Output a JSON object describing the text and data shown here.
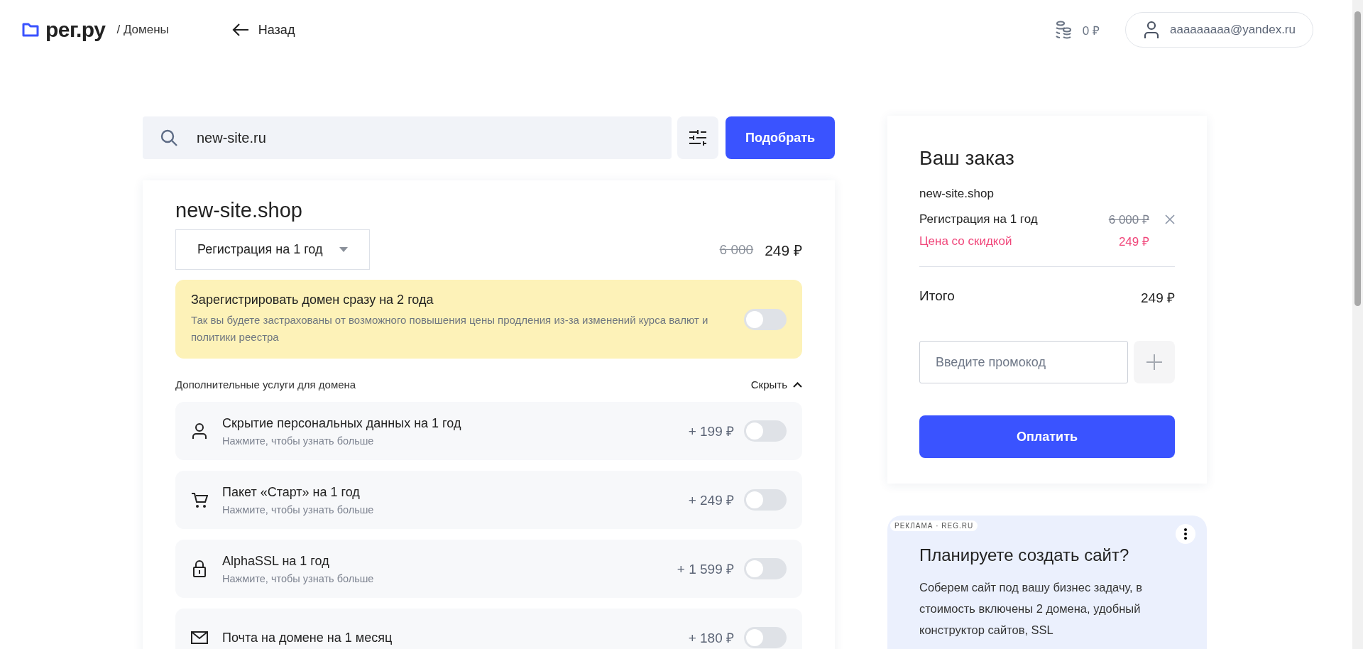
{
  "header": {
    "logo": "рег.ру",
    "section": "/ Домены",
    "back": "Назад",
    "balance": "0 ₽",
    "user": "aaaaaaaaa@yandex.ru"
  },
  "search": {
    "value": "new-site.ru",
    "button": "Подобрать"
  },
  "domain": {
    "name": "new-site.shop",
    "period": "Регистрация на 1 год",
    "old_price": "6 000",
    "price": "249 ₽",
    "promo": {
      "title": "Зарегистрировать домен сразу на 2 года",
      "text": "Так вы будете застрахованы от возможного повышения цены продления из-за изменений курса валют и политики реестра",
      "on": false
    },
    "services_title": "Дополнительные услуги для домена",
    "toggle_label": "Скрыть",
    "expanded": true,
    "services": [
      {
        "kind": "person",
        "title": "Скрытие персональных данных на 1 год",
        "subtitle": "Нажмите, чтобы узнать больше",
        "price": "+ 199 ₽",
        "on": false
      },
      {
        "kind": "cart",
        "title": "Пакет «Старт» на 1 год",
        "subtitle": "Нажмите, чтобы узнать больше",
        "price": "+ 249 ₽",
        "on": false
      },
      {
        "kind": "lock",
        "title": "AlphaSSL на 1 год",
        "subtitle": "Нажмите, чтобы узнать больше",
        "price": "+ 1 599 ₽",
        "on": false
      },
      {
        "kind": "mail",
        "title": "Почта на домене на 1 месяц",
        "price": "+ 180 ₽",
        "on": false
      }
    ]
  },
  "order": {
    "title": "Ваш заказ",
    "domain": "new-site.shop",
    "lines": [
      {
        "kind": "old",
        "label": "Регистрация на 1 год",
        "value": "6 000 ₽"
      },
      {
        "kind": "discount",
        "label": "Цена со скидкой",
        "value": "249 ₽"
      }
    ],
    "total_label": "Итого",
    "total": "249 ₽",
    "promo_placeholder": "Введите промокод",
    "pay": "Оплатить"
  },
  "ad": {
    "label": "РЕКЛАМА · REG.RU",
    "title": "Планируете создать сайт?",
    "text": "Соберем сайт под вашу бизнес задачу, в стоимость включены 2 домена, удобный конструктор сайтов, SSL"
  }
}
